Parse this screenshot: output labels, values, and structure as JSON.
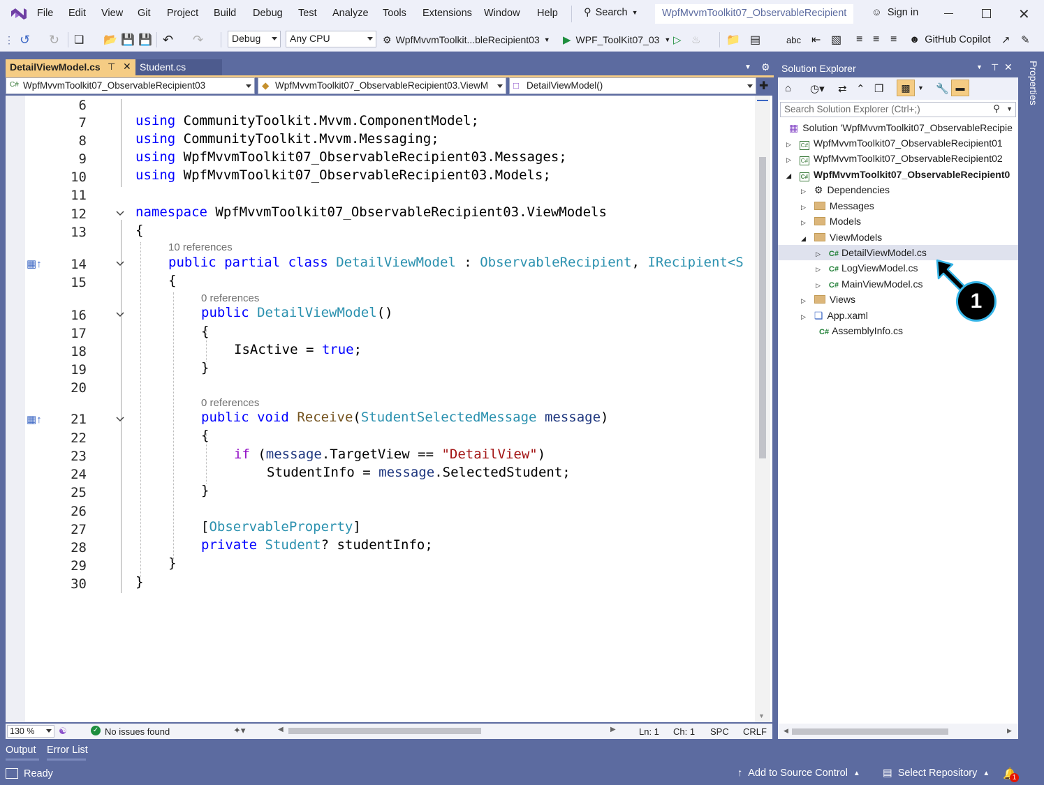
{
  "menu": [
    "File",
    "Edit",
    "View",
    "Git",
    "Project",
    "Build",
    "Debug",
    "Test",
    "Analyze",
    "Tools",
    "Extensions",
    "Window",
    "Help"
  ],
  "search_label": "Search",
  "window_title": "WpfMvvmToolkit07_ObservableRecipient",
  "sign_in": "Sign in",
  "toolbar": {
    "config": "Debug",
    "platform": "Any CPU",
    "startup_project": "WpfMvvmToolkit...bleRecipient03",
    "run_target": "WPF_ToolKit07_03",
    "copilot": "GitHub Copilot"
  },
  "tabs": [
    {
      "label": "DetailViewModel.cs",
      "active": true
    },
    {
      "label": "Student.cs",
      "active": false
    }
  ],
  "nav": {
    "project": "WpfMvvmToolkit07_ObservableRecipient03",
    "type": "WpfMvvmToolkit07_ObservableRecipient03.ViewM",
    "member": "DetailViewModel()"
  },
  "code": {
    "line_numbers": [
      "6",
      "7",
      "8",
      "9",
      "10",
      "11",
      "12",
      "13",
      "14",
      "15",
      "16",
      "17",
      "18",
      "19",
      "20",
      "21",
      "22",
      "23",
      "24",
      "25",
      "26",
      "27",
      "28",
      "29",
      "30"
    ],
    "using1": "CommunityToolkit.Mvvm.ComponentModel;",
    "using2": "CommunityToolkit.Mvvm.Messaging;",
    "using3": "WpfMvvmToolkit07_ObservableRecipient03.Messages;",
    "using4": "WpfMvvmToolkit07_ObservableRecipient03.Models;",
    "kw_using": "using",
    "kw_namespace": "namespace",
    "namespace_name": "WpfMvvmToolkit07_ObservableRecipient03.ViewModels",
    "refs_class": "10 references",
    "refs_ctor": "0 references",
    "refs_receive": "0 references",
    "kw_public_partial_class": "public partial class",
    "class_name": "DetailViewModel",
    "colon": ":",
    "base1": "ObservableRecipient",
    "comma": ",",
    "base2": "IRecipient",
    "base2_tail": "<S",
    "kw_public": "public",
    "ctor_name": "DetailViewModel",
    "ctor_parens": "()",
    "isactive": "IsActive = ",
    "kw_true": "true",
    "semi": ";",
    "kw_void": "void",
    "method_name": "Receive",
    "param_type": "StudentSelectedMessage",
    "param_name": "message",
    "kw_if": "if",
    "if_open": " (",
    "target_view": ".TargetView == ",
    "detail_str": "\"DetailView\"",
    "close_paren": ")",
    "student_info_assign": "StudentInfo = ",
    "selected_student": ".SelectedStudent;",
    "attr_open": "[",
    "attr_name": "ObservableProperty",
    "attr_close": "]",
    "kw_private": "private",
    "student_type": "Student",
    "field": "? studentInfo;",
    "brace_open": "{",
    "brace_close": "}"
  },
  "editor_status": {
    "zoom": "130 %",
    "issues": "No issues found",
    "ln": "Ln: 1",
    "ch": "Ch: 1",
    "spc": "SPC",
    "crlf": "CRLF"
  },
  "solution_explorer": {
    "title": "Solution Explorer",
    "search_placeholder": "Search Solution Explorer (Ctrl+;)",
    "solution": "Solution 'WpfMvvmToolkit07_ObservableRecipie",
    "proj1": "WpfMvvmToolkit07_ObservableRecipient01",
    "proj2": "WpfMvvmToolkit07_ObservableRecipient02",
    "proj3": "WpfMvvmToolkit07_ObservableRecipient0",
    "dependencies": "Dependencies",
    "messages": "Messages",
    "models": "Models",
    "viewmodels": "ViewModels",
    "file1": "DetailViewModel.cs",
    "file2": "LogViewModel.cs",
    "file3": "MainViewModel.cs",
    "views": "Views",
    "app": "App.xaml",
    "assembly": "AssemblyInfo.cs"
  },
  "properties_label": "Properties",
  "callout_number": "1",
  "bottom_tabs": [
    "Output",
    "Error List"
  ],
  "statusbar": {
    "ready": "Ready",
    "source_control": "Add to Source Control",
    "repository": "Select Repository",
    "notifications": "1"
  },
  "colors": {
    "chrome": "#5c6ba0",
    "toolbar_bg": "#eef0f9",
    "active_tab": "#f5cc84",
    "keyword": "#0000ff",
    "type": "#2b91af",
    "string": "#a31515"
  }
}
